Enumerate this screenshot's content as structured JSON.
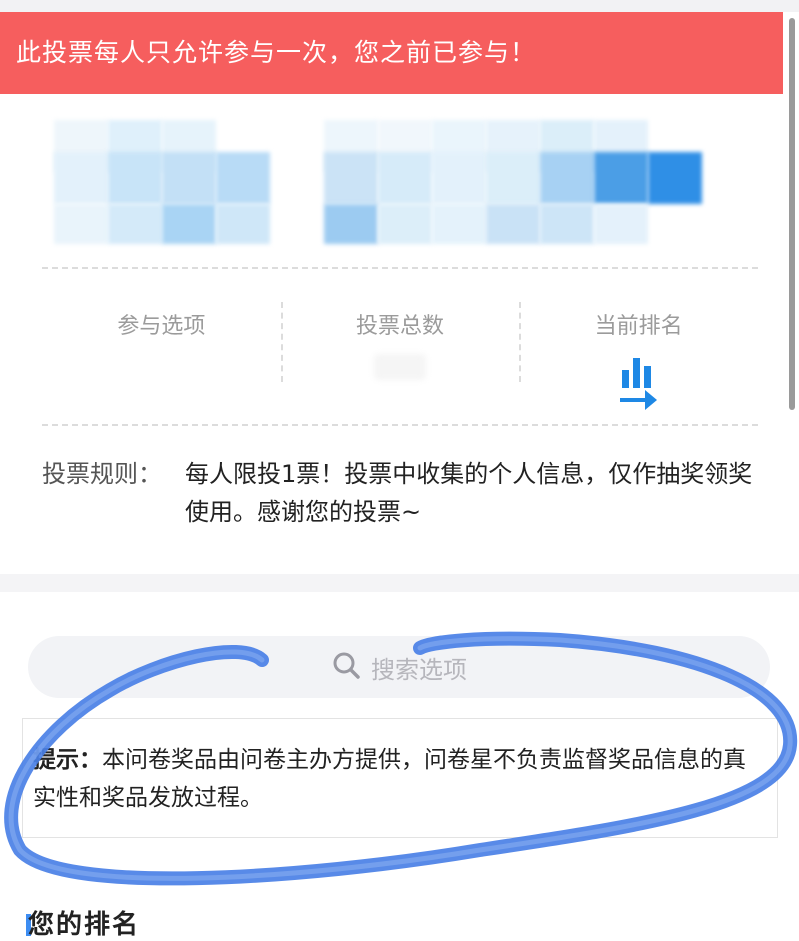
{
  "banner": {
    "message": "此投票每人只允许参与一次，您之前已参与！"
  },
  "stats": [
    {
      "label": "参与选项"
    },
    {
      "label": "投票总数"
    },
    {
      "label": "当前排名",
      "icon": "bar-chart-arrow-icon"
    }
  ],
  "rules": {
    "label": "投票规则：",
    "text": "每人限投1票！投票中收集的个人信息，仅作抽奖领奖使用。感谢您的投票~"
  },
  "search": {
    "placeholder": "搜索选项",
    "icon": "search-icon"
  },
  "notice": {
    "title": "提示：",
    "text": "本问卷奖品由问卷主办方提供，问卷星不负责监督奖品信息的真实性和奖品发放过程。"
  },
  "section": {
    "title": "您的排名"
  },
  "colors": {
    "banner": "#f65e5e",
    "accent": "#1e88e5",
    "annotation": "#4a80e6"
  }
}
